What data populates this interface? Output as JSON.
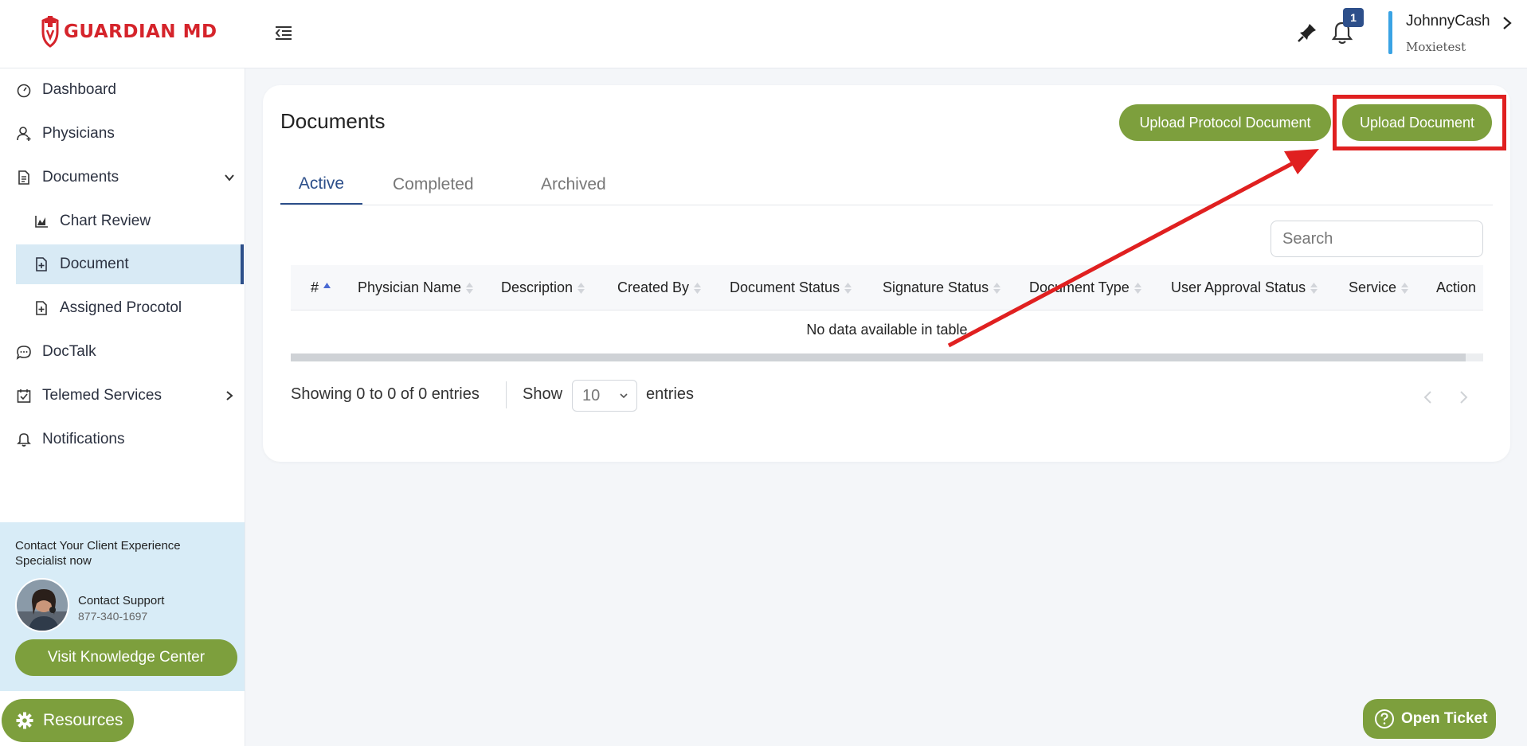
{
  "brand": {
    "logo_text": "GUARDIAN MD",
    "accent": "#d5242b",
    "green": "#7d9f3d",
    "navy": "#2d4f8a"
  },
  "header": {
    "notification_count": "1",
    "user_name": "JohnnyCash",
    "user_org": "Moxietest"
  },
  "sidebar": {
    "items": [
      {
        "label": "Dashboard",
        "icon": "dashboard-icon"
      },
      {
        "label": "Physicians",
        "icon": "user-icon"
      },
      {
        "label": "Documents",
        "icon": "document-icon"
      },
      {
        "label": "Chart Review",
        "icon": "chart-icon"
      },
      {
        "label": "Document",
        "icon": "file-icon"
      },
      {
        "label": "Assigned Procotol",
        "icon": "file-icon"
      },
      {
        "label": "DocTalk",
        "icon": "chat-icon"
      },
      {
        "label": "Telemed Services",
        "icon": "calendar-check-icon"
      },
      {
        "label": "Notifications",
        "icon": "bell-icon"
      }
    ],
    "contact": {
      "heading": "Contact Your Client Experience Specialist now",
      "title": "Contact Support",
      "phone": "877-340-1697",
      "knowledge_button": "Visit Knowledge Center"
    },
    "resources_button": "Resources"
  },
  "main": {
    "title": "Documents",
    "upload_protocol_label": "Upload Protocol Document",
    "upload_label": "Upload Document",
    "tabs": [
      {
        "label": "Active",
        "active": true
      },
      {
        "label": "Completed",
        "active": false
      },
      {
        "label": "Archived",
        "active": false
      }
    ],
    "search_placeholder": "Search",
    "columns": [
      "#",
      "Physician Name",
      "Description",
      "Created By",
      "Document Status",
      "Signature Status",
      "Document Type",
      "User Approval Status",
      "Service",
      "Action"
    ],
    "empty_message": "No data available in table",
    "showing": "Showing 0 to 0 of 0 entries",
    "show_label": "Show",
    "page_length": "10",
    "entries_label": "entries"
  },
  "open_ticket_label": "Open Ticket"
}
